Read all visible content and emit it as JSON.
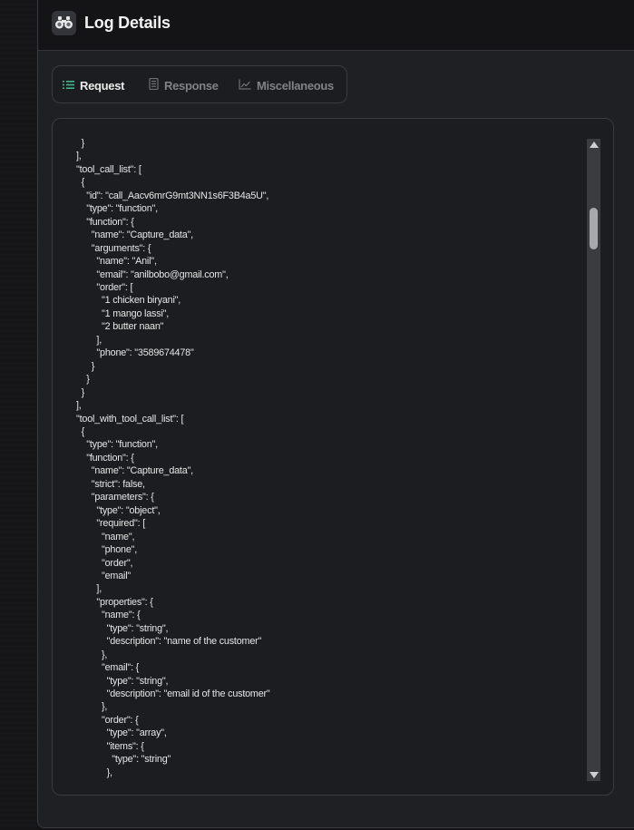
{
  "header": {
    "title": "Log Details",
    "icon": "binoculars-icon"
  },
  "tabs": [
    {
      "label": "Request",
      "icon": "list-icon",
      "active": true
    },
    {
      "label": "Response",
      "icon": "document-icon",
      "active": false
    },
    {
      "label": "Miscellaneous",
      "icon": "chart-line-icon",
      "active": false
    }
  ],
  "code_text": "  }\n],\n\"tool_call_list\": [\n  {\n    \"id\": \"call_Aacv6mrG9mt3NN1s6F3B4a5U\",\n    \"type\": \"function\",\n    \"function\": {\n      \"name\": \"Capture_data\",\n      \"arguments\": {\n        \"name\": \"Anil\",\n        \"email\": \"anilbobo@gmail.com\",\n        \"order\": [\n          \"1 chicken biryani\",\n          \"1 mango lassi\",\n          \"2 butter naan\"\n        ],\n        \"phone\": \"3589674478\"\n      }\n    }\n  }\n],\n\"tool_with_tool_call_list\": [\n  {\n    \"type\": \"function\",\n    \"function\": {\n      \"name\": \"Capture_data\",\n      \"strict\": false,\n      \"parameters\": {\n        \"type\": \"object\",\n        \"required\": [\n          \"name\",\n          \"phone\",\n          \"order\",\n          \"email\"\n        ],\n        \"properties\": {\n          \"name\": {\n            \"type\": \"string\",\n            \"description\": \"name of the customer\"\n          },\n          \"email\": {\n            \"type\": \"string\",\n            \"description\": \"email id of the customer\"\n          },\n          \"order\": {\n            \"type\": \"array\",\n            \"items\": {\n              \"type\": \"string\"\n            },",
  "colors": {
    "background": "#141416",
    "panel": "#1f2023",
    "text": "#e6e6e6",
    "tab_inactive": "#808288",
    "accent": "#3fb68b"
  }
}
